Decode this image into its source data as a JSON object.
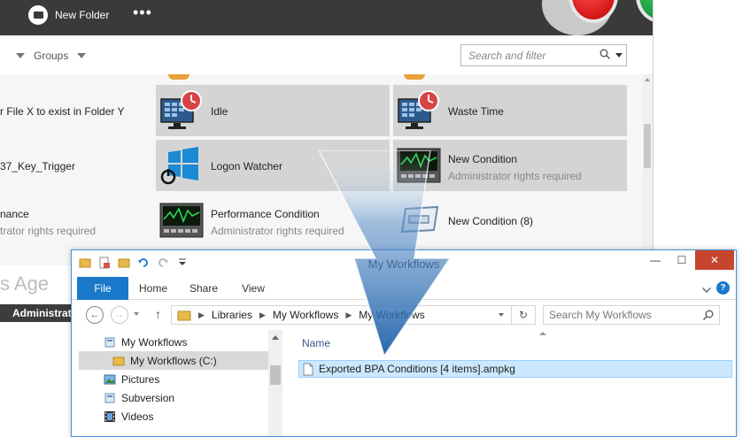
{
  "bpa": {
    "new_folder_label": "New Folder",
    "more_label": "•••",
    "groups_label": "Groups",
    "search_placeholder": "Search and filter",
    "left_items": [
      {
        "title": "r File X to exist in Folder Y",
        "sub": ""
      },
      {
        "title": "37_Key_Trigger",
        "sub": ""
      },
      {
        "title": "nance",
        "sub": "trator rights required"
      }
    ],
    "tiles": [
      {
        "title": "Idle",
        "sub": "",
        "icon": "monitor-clock-icon"
      },
      {
        "title": "Waste Time",
        "sub": "",
        "icon": "monitor-clock-icon"
      },
      {
        "title": "Logon Watcher",
        "sub": "",
        "icon": "windows-power-icon"
      },
      {
        "title": "New Condition",
        "sub": "Administrator rights required",
        "icon": "performance-monitor-icon"
      },
      {
        "title": "Performance Condition",
        "sub": "Administrator rights required",
        "icon": "performance-monitor-icon"
      },
      {
        "title": "New Condition (8)",
        "sub": "",
        "icon": "generic-condition-icon"
      }
    ],
    "ghost_tabs": "s    Age",
    "ghost_admin": "Administrat"
  },
  "explorer": {
    "title": "My Workflows",
    "window_buttons": {
      "min": "—",
      "max": "☐",
      "close": "✕"
    },
    "ribbon_tabs": [
      "File",
      "Home",
      "Share",
      "View"
    ],
    "address_parts": [
      "Libraries",
      "My Workflows",
      "My Workflows"
    ],
    "search_placeholder": "Search My Workflows",
    "tree": [
      {
        "label": "My Workflows",
        "icon": "library-icon",
        "selected": false
      },
      {
        "label": "My Workflows (C:)",
        "icon": "folder-icon",
        "selected": true
      },
      {
        "label": "Pictures",
        "icon": "pictures-library-icon",
        "selected": false
      },
      {
        "label": "Subversion",
        "icon": "library-icon",
        "selected": false
      },
      {
        "label": "Videos",
        "icon": "videos-library-icon",
        "selected": false
      }
    ],
    "column_name": "Name",
    "file_name": "Exported BPA Conditions [4 items].ampkg"
  }
}
